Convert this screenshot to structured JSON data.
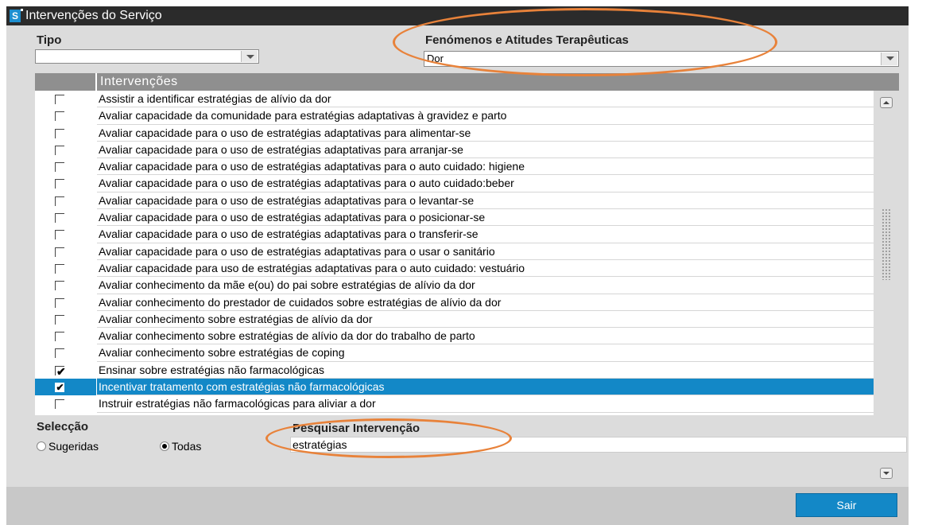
{
  "window": {
    "title": "Intervenções do Serviço",
    "app_icon": "S"
  },
  "tipo": {
    "label": "Tipo",
    "value": ""
  },
  "fenomenos": {
    "label": "Fenómenos e Atitudes Terapêuticas",
    "value": "Dor"
  },
  "table": {
    "header": "Intervenções",
    "rows": [
      {
        "text": "Assistir a identificar estratégias de alívio da dor",
        "checked": false
      },
      {
        "text": "Avaliar capacidade da comunidade para estratégias adaptativas à gravidez e parto",
        "checked": false
      },
      {
        "text": "Avaliar capacidade para o uso de estratégias adaptativas para alimentar-se",
        "checked": false
      },
      {
        "text": "Avaliar capacidade para o uso de estratégias adaptativas para arranjar-se",
        "checked": false
      },
      {
        "text": "Avaliar capacidade para o uso de estratégias adaptativas para o auto cuidado: higiene",
        "checked": false
      },
      {
        "text": "Avaliar capacidade para o uso de estratégias adaptativas para o auto cuidado:beber",
        "checked": false
      },
      {
        "text": "Avaliar capacidade para o uso de estratégias adaptativas para o levantar-se",
        "checked": false
      },
      {
        "text": "Avaliar capacidade para o uso de estratégias adaptativas para o posicionar-se",
        "checked": false
      },
      {
        "text": "Avaliar capacidade para o uso de estratégias adaptativas para o transferir-se",
        "checked": false
      },
      {
        "text": "Avaliar capacidade para o uso de estratégias adaptativas para o usar o sanitário",
        "checked": false
      },
      {
        "text": "Avaliar capacidade para uso de estratégias adaptativas para o auto cuidado: vestuário",
        "checked": false
      },
      {
        "text": "Avaliar conhecimento da mãe e(ou) do pai sobre estratégias de alívio da dor",
        "checked": false
      },
      {
        "text": "Avaliar conhecimento do prestador de cuidados sobre estratégias de alívio da dor",
        "checked": false
      },
      {
        "text": "Avaliar conhecimento sobre estratégias de alívio da dor",
        "checked": false
      },
      {
        "text": "Avaliar conhecimento sobre estratégias de alívio da dor do trabalho de parto",
        "checked": false
      },
      {
        "text": "Avaliar conhecimento sobre estratégias de coping",
        "checked": false
      },
      {
        "text": "Ensinar sobre estratégias não farmacológicas",
        "checked": true
      },
      {
        "text": "Incentivar tratamento com estratégias não farmacológicas",
        "checked": true,
        "selected": true
      },
      {
        "text": "Instruir estratégias não farmacológicas para aliviar a dor",
        "checked": false
      }
    ]
  },
  "seleccao": {
    "label": "Selecção",
    "options": [
      {
        "label": "Sugeridas",
        "selected": false
      },
      {
        "label": "Todas",
        "selected": true
      }
    ]
  },
  "pesquisa": {
    "label": "Pesquisar Intervenção",
    "value": "estratégias"
  },
  "buttons": {
    "sair": "Sair"
  },
  "colors": {
    "accent": "#1388c7",
    "annotation": "#e8823a",
    "header": "#8f8f8f",
    "titlebar": "#2b2b2b"
  }
}
